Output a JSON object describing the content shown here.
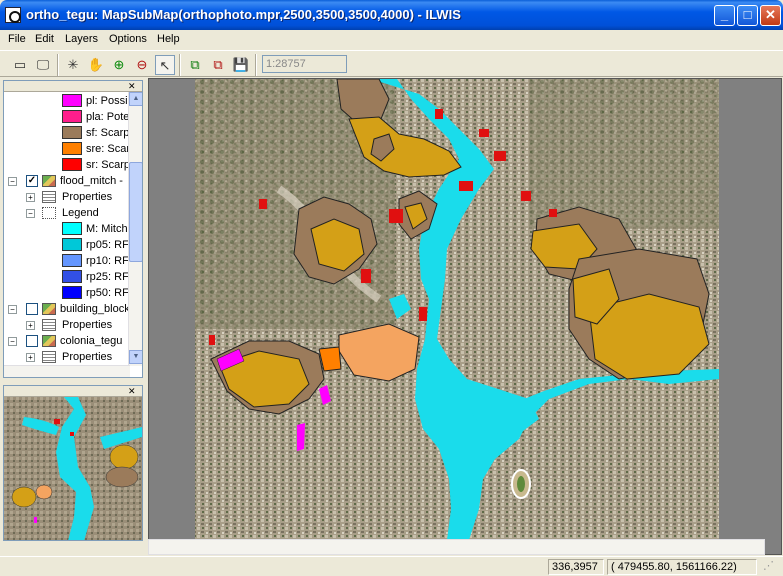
{
  "window": {
    "title": "ortho_tegu: MapSubMap(orthophoto.mpr,2500,3500,3500,4000) - ILWIS",
    "minimize": "_",
    "maximize": "□",
    "close": "✕"
  },
  "menu": [
    "File",
    "Edit",
    "Layers",
    "Options",
    "Help"
  ],
  "toolbar": {
    "scale_value": "1:28757",
    "icons": [
      "new-window-icon",
      "display-icon",
      "entire-map-icon",
      "pan-hand-icon",
      "zoom-in-icon",
      "zoom-out-icon",
      "select-pointer-icon",
      "add-layer-icon",
      "remove-layer-icon",
      "save-icon"
    ]
  },
  "tree": {
    "items": [
      {
        "kind": "legend",
        "color": "#FF00FF",
        "label": "pl: Possil"
      },
      {
        "kind": "legend",
        "color": "#FF1E8C",
        "label": "pla: Pote"
      },
      {
        "kind": "legend",
        "color": "#9B7B5B",
        "label": "sf: Scarp"
      },
      {
        "kind": "legend",
        "color": "#FF8000",
        "label": "sre: Scar"
      },
      {
        "kind": "legend",
        "color": "#FF0000",
        "label": "sr: Scarp"
      },
      {
        "kind": "layer",
        "label": "flood_mitch -",
        "checked": true
      },
      {
        "kind": "properties",
        "label": "Properties"
      },
      {
        "kind": "legend-header",
        "label": "Legend"
      },
      {
        "kind": "legend",
        "color": "#00FFFF",
        "label": "M: Mitch"
      },
      {
        "kind": "legend",
        "color": "#00C8D8",
        "label": "rp05: RF"
      },
      {
        "kind": "legend",
        "color": "#6496FF",
        "label": "rp10: RF"
      },
      {
        "kind": "legend",
        "color": "#3250E6",
        "label": "rp25: RF"
      },
      {
        "kind": "legend",
        "color": "#0000FF",
        "label": "rp50: RF"
      },
      {
        "kind": "layer",
        "label": "building_block",
        "checked": false
      },
      {
        "kind": "properties",
        "label": "Properties"
      },
      {
        "kind": "layer",
        "label": "colonia_tegu",
        "checked": false
      },
      {
        "kind": "properties",
        "label": "Properties"
      }
    ]
  },
  "status": {
    "rowcol": "336,3957",
    "coords": "(  479455.80,  1561166.22)"
  },
  "colors": {
    "river": "#1ADCEB",
    "landslide_tan": "#D4A017",
    "landslide_brown": "#9B7B5B",
    "landslide_orange": "#F4A460",
    "scarp_red": "#E01010",
    "possible_magenta": "#FF00FF",
    "ortho_base": "#9A8E78"
  }
}
